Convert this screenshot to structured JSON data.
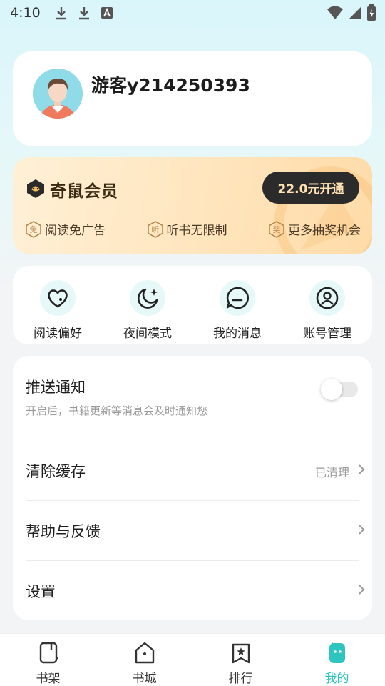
{
  "status_bar": {
    "time": "4:10",
    "icons": [
      "download-icon",
      "download-icon",
      "font-icon"
    ],
    "right_icons": [
      "wifi-icon",
      "signal-icon",
      "battery-icon"
    ]
  },
  "profile": {
    "username": "游客y214250393",
    "avatar": "avatar"
  },
  "vip": {
    "title": "奇鼠会员",
    "button_label": "22.0元开通",
    "benefits": [
      {
        "icon_char": "免",
        "label": "阅读免广告"
      },
      {
        "icon_char": "听",
        "label": "听书无限制"
      },
      {
        "icon_char": "奖",
        "label": "更多抽奖机会"
      }
    ]
  },
  "quick_actions": [
    {
      "label": "阅读偏好",
      "icon": "heart-icon"
    },
    {
      "label": "夜间模式",
      "icon": "moon-icon"
    },
    {
      "label": "我的消息",
      "icon": "message-icon"
    },
    {
      "label": "账号管理",
      "icon": "account-icon"
    }
  ],
  "settings": {
    "push": {
      "title": "推送通知",
      "subtitle": "开启后，书籍更新等消息会及时通知您",
      "enabled": false
    },
    "cache": {
      "title": "清除缓存",
      "status": "已清理"
    },
    "help": {
      "title": "帮助与反馈"
    },
    "settings": {
      "title": "设置"
    }
  },
  "bottom_nav": [
    {
      "label": "书架",
      "icon": "bookshelf-icon",
      "active": false
    },
    {
      "label": "书城",
      "icon": "bookstore-icon",
      "active": false
    },
    {
      "label": "排行",
      "icon": "ranking-icon",
      "active": false
    },
    {
      "label": "我的",
      "icon": "profile-icon",
      "active": true
    }
  ],
  "colors": {
    "accent": "#2ec5c0",
    "vip_button": "#2b2b2b",
    "vip_text": "#ffe2b3"
  }
}
